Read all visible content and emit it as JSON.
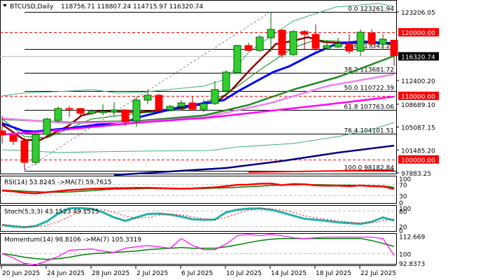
{
  "header": {
    "symbol_label": "BTCUSD,Daily",
    "ohlc": "118756.71 118807.24 114715.97 116320.74",
    "menu_icon": "triangle-down-icon"
  },
  "colors": {
    "bull": "#32cd32",
    "bear": "#ff0000",
    "ma_fast": "#8b0000",
    "ma_mid": "#0000ff",
    "ma_10": "#008000",
    "ma_50": "#228b22",
    "ma_100": "#ee82ee",
    "ma_200": "#ff00ff",
    "ma_long": "#000080",
    "bands": "#3cb371",
    "level": "#ff0000",
    "fib": "#000000",
    "stoch_main": "#20b2aa",
    "stoch_signal": "#ff0000",
    "mom": "#ff00ff",
    "mom_ma": "#008000"
  },
  "chart_data": {
    "type": "candlestick",
    "title": "BTCUSD,Daily",
    "ylim": [
      97660,
      124860
    ],
    "dates": [
      "20 Jun 2025",
      "24 Jun 2025",
      "28 Jun 2025",
      "2 Jul 2025",
      "6 Jul 2025",
      "10 Jul 2025",
      "14 Jul 2025",
      "18 Jul 2025",
      "22 Jul 2025"
    ],
    "date_every_bars": 4,
    "ohlc": [
      [
        104489,
        106800,
        102508,
        103829
      ],
      [
        103829,
        103829,
        102288,
        102838
      ],
      [
        102948,
        103388,
        98324,
        99535
      ],
      [
        99535,
        104159,
        99095,
        103939
      ],
      [
        103939,
        106581,
        103700,
        106361
      ],
      [
        106141,
        108343,
        105811,
        108013
      ],
      [
        108013,
        108343,
        106692,
        107902
      ],
      [
        108013,
        108100,
        106692,
        107242
      ],
      [
        107242,
        107682,
        106912,
        107572
      ],
      [
        107352,
        108673,
        106912,
        107572
      ],
      [
        107462,
        109003,
        106802,
        107792
      ],
      [
        107792,
        107900,
        105256,
        105921
      ],
      [
        106031,
        109884,
        105150,
        109334
      ],
      [
        109334,
        110985,
        108673,
        110105
      ],
      [
        110105,
        110300,
        107600,
        107792
      ],
      [
        107792,
        108563,
        107682,
        108343
      ],
      [
        108343,
        109334,
        108200,
        108893
      ],
      [
        108893,
        109884,
        107682,
        107902
      ],
      [
        107902,
        109444,
        107462,
        108783
      ],
      [
        108783,
        112306,
        108563,
        110985
      ],
      [
        110765,
        114068,
        110500,
        113737
      ],
      [
        113627,
        118032,
        113516,
        117921
      ],
      [
        117921,
        118362,
        117040,
        117151
      ],
      [
        117151,
        119573,
        116900,
        119242
      ],
      [
        119132,
        123261.94,
        116930,
        120454
      ],
      [
        120343,
        120454,
        115940,
        116490
      ],
      [
        116490,
        120343,
        116270,
        120123
      ],
      [
        120123,
        120343,
        117371,
        119683
      ],
      [
        119683,
        121224,
        117000,
        117481
      ],
      [
        117481,
        118692,
        117261,
        117921
      ],
      [
        117701,
        119132,
        117481,
        118251
      ],
      [
        118251,
        119683,
        116600,
        117040
      ],
      [
        117040,
        120454,
        116270,
        120013
      ],
      [
        119903,
        120454,
        117481,
        118141
      ],
      [
        118141,
        119683,
        117261,
        118912
      ],
      [
        118756.71,
        118807.24,
        114715.97,
        116320.74
      ]
    ],
    "overlays": [
      {
        "name": "ma-fast",
        "color": "ma_fast",
        "width": 2.5,
        "points": [
          [
            0,
            105480
          ],
          [
            2,
            103058
          ],
          [
            3.4,
            103058
          ],
          [
            5.9,
            105260
          ],
          [
            7.1,
            106912
          ],
          [
            8.6,
            107572
          ],
          [
            12.3,
            107462
          ],
          [
            15.9,
            108013
          ],
          [
            19.2,
            109114
          ],
          [
            20.4,
            110765
          ],
          [
            22.3,
            114398
          ],
          [
            24.2,
            117701
          ],
          [
            24.4,
            118141
          ],
          [
            26.1,
            118692
          ],
          [
            27.3,
            119242
          ],
          [
            28.7,
            118471
          ],
          [
            30.9,
            118251
          ],
          [
            33,
            118471
          ],
          [
            35,
            118141
          ]
        ]
      },
      {
        "name": "ma-10",
        "color": "ma_10",
        "width": 1,
        "points": [
          [
            0,
            106361
          ],
          [
            2,
            103608
          ],
          [
            4,
            103388
          ],
          [
            8,
            106361
          ],
          [
            12,
            107242
          ],
          [
            16,
            107792
          ],
          [
            20,
            110214
          ],
          [
            23,
            114068
          ],
          [
            26,
            117591
          ],
          [
            28,
            118802
          ],
          [
            31,
            118471
          ],
          [
            35,
            118031
          ]
        ]
      },
      {
        "name": "ma-mid",
        "color": "ma_mid",
        "width": 3,
        "points": [
          [
            0,
            105700
          ],
          [
            1.9,
            104489
          ],
          [
            2.9,
            104380
          ],
          [
            6.1,
            104930
          ],
          [
            9.2,
            105590
          ],
          [
            11.5,
            106141
          ],
          [
            12.3,
            106692
          ],
          [
            15.9,
            108233
          ],
          [
            19.8,
            109334
          ],
          [
            21.1,
            110765
          ],
          [
            24.2,
            113737
          ],
          [
            25.6,
            114618
          ],
          [
            27.8,
            116600
          ],
          [
            29.8,
            118141
          ],
          [
            31.9,
            118582
          ],
          [
            35,
            118251
          ]
        ]
      },
      {
        "name": "ma-50",
        "color": "ma_50",
        "width": 2.5,
        "points": [
          [
            0,
            106361
          ],
          [
            6,
            105811
          ],
          [
            12,
            106031
          ],
          [
            18,
            106912
          ],
          [
            22,
            108563
          ],
          [
            26,
            110985
          ],
          [
            30,
            112967
          ],
          [
            35,
            116270
          ]
        ]
      },
      {
        "name": "ma-100",
        "color": "ma_100",
        "width": 2.5,
        "points": [
          [
            0,
            106471
          ],
          [
            6,
            105700
          ],
          [
            12.3,
            105921
          ],
          [
            18,
            106581
          ],
          [
            24,
            108893
          ],
          [
            29,
            111535
          ],
          [
            35,
            113407
          ]
        ]
      },
      {
        "name": "ma-200",
        "color": "ma_200",
        "width": 2.5,
        "points": [
          [
            0,
            103939
          ],
          [
            3,
            104269
          ],
          [
            12.3,
            105811
          ],
          [
            18.5,
            106581
          ],
          [
            28.6,
            108563
          ],
          [
            35,
            109884
          ]
        ]
      },
      {
        "name": "ma-long",
        "color": "ma_long",
        "width": 2.5,
        "points": [
          [
            10,
            97553
          ],
          [
            20,
            98654
          ],
          [
            25,
            99755
          ],
          [
            30,
            101076
          ],
          [
            35,
            102178
          ]
        ]
      },
      {
        "name": "ma-red-long",
        "color": "level",
        "width": 2,
        "points": [
          [
            22,
            97993
          ],
          [
            35,
            98324
          ]
        ]
      },
      {
        "name": "band-upper",
        "color": "bands",
        "width": 1,
        "points": [
          [
            0,
            109994
          ],
          [
            1.9,
            110434
          ],
          [
            6.1,
            110765
          ],
          [
            8.1,
            110985
          ],
          [
            10.3,
            110434
          ],
          [
            12.3,
            110544
          ],
          [
            18,
            111535
          ],
          [
            20,
            112636
          ],
          [
            21.1,
            114948
          ],
          [
            22.1,
            117040
          ],
          [
            26,
            121775
          ],
          [
            29.8,
            123977
          ],
          [
            33.6,
            124527
          ],
          [
            35,
            124087
          ]
        ]
      },
      {
        "name": "band-lower",
        "color": "bands",
        "width": 1,
        "points": [
          [
            0,
            101516
          ],
          [
            2,
            101406
          ],
          [
            5,
            101076
          ],
          [
            8,
            101186
          ],
          [
            12,
            101296
          ],
          [
            18.6,
            101406
          ],
          [
            21,
            101957
          ],
          [
            26,
            102508
          ],
          [
            30,
            103608
          ],
          [
            33,
            104709
          ],
          [
            35,
            105811
          ]
        ]
      }
    ],
    "fibonacci": [
      {
        "label": "0.0 123261.94",
        "price": 123261.94
      },
      {
        "label": "23.6 117343.27",
        "price": 117343.27
      },
      {
        "label": "38.2 113681.72",
        "price": 113681.72
      },
      {
        "label": "50.0 110722.39",
        "price": 110722.39
      },
      {
        "label": "61.8 107763.06",
        "price": 107763.06
      },
      {
        "label": "76.4 104101.51",
        "price": 104101.51
      },
      {
        "label": "100.0 98182.84",
        "price": 98182.84
      }
    ],
    "levels": [
      {
        "label": "120000.00",
        "price": 120000
      },
      {
        "label": "110000.00",
        "price": 110000
      },
      {
        "label": "100000.00",
        "price": 100000
      }
    ],
    "current_price": {
      "label": "116320.74",
      "price": 116320.74
    },
    "axis_ticks": [
      {
        "label": "123206.05",
        "price": 123206.05
      },
      {
        "label": "112400.20",
        "price": 112400.2
      },
      {
        "label": "108689.10",
        "price": 108689.1
      },
      {
        "label": "105087.15",
        "price": 105087.15
      },
      {
        "label": "101485.20",
        "price": 101485.2
      },
      {
        "label": "97883.25",
        "price": 97883.25
      }
    ],
    "indicators": [
      {
        "name": "rsi",
        "title": "RSI(14) 53.8245  ->MA(7) 59.7615",
        "ylim": [
          0,
          100
        ],
        "levels": [
          70,
          30
        ],
        "ticks": [
          "100",
          "70",
          "30",
          "0"
        ],
        "tick_values": [
          100,
          70,
          30,
          0
        ],
        "series": [
          {
            "name": "rsi-ma",
            "color": "ma_10",
            "width": 1.5,
            "values": [
              50,
              48,
              46,
              44,
              42,
              42,
              43,
              45,
              48,
              51,
              53,
              54,
              55,
              56,
              56,
              56,
              56,
              56,
              56,
              57,
              58,
              60,
              62,
              64,
              67,
              68,
              69,
              70,
              70,
              69,
              68,
              68,
              67,
              66,
              65,
              60
            ]
          },
          {
            "name": "rsi-line",
            "color": "level",
            "width": 2.5,
            "values": [
              48,
              45,
              40,
              38,
              42,
              46,
              50,
              52,
              55,
              56,
              57,
              57,
              58,
              58,
              57,
              56,
              55,
              56,
              58,
              60,
              64,
              69,
              70,
              73,
              74,
              68,
              72,
              71,
              67,
              66,
              66,
              64,
              67,
              64,
              63,
              54
            ]
          }
        ]
      },
      {
        "name": "stoch",
        "title": "Stoch(5,3,3) 43.1523 49.1515",
        "ylim": [
          0,
          100
        ],
        "levels": [
          80,
          20
        ],
        "ticks": [
          "100",
          "80",
          "20",
          "0"
        ],
        "tick_values": [
          100,
          80,
          20,
          0
        ],
        "series": [
          {
            "name": "stoch-main",
            "color": "stoch_main",
            "width": 3,
            "values": [
              26,
              20,
              17,
              22,
              40,
              70,
              90,
              91,
              88,
              75,
              55,
              42,
              55,
              68,
              70,
              66,
              58,
              48,
              46,
              47,
              75,
              85,
              89,
              90,
              85,
              74,
              62,
              50,
              46,
              42,
              36,
              33,
              30,
              38,
              55,
              43
            ]
          },
          {
            "name": "stoch-signal",
            "color": "stoch_signal",
            "width": 1,
            "dash": "2,3",
            "values": [
              28,
              24,
              20,
              19,
              25,
              38,
              58,
              78,
              88,
              85,
              75,
              60,
              52,
              55,
              64,
              68,
              65,
              57,
              50,
              46,
              55,
              70,
              84,
              88,
              88,
              84,
              75,
              62,
              53,
              48,
              42,
              37,
              33,
              34,
              42,
              49
            ]
          }
        ]
      },
      {
        "name": "momentum",
        "title": "Momentum(14) 98.8106  ->MA(7) 105.3319",
        "ylim": [
          92.2,
          114.4
        ],
        "levels": [
          100
        ],
        "ticks": [
          "112.669",
          "100",
          "92.8373"
        ],
        "tick_values": [
          112.669,
          100,
          92.8373
        ],
        "series": [
          {
            "name": "momentum-ma",
            "color": "mom_ma",
            "width": 1.5,
            "values": [
              100,
              99,
              97.5,
              96.5,
              96,
              96.5,
              97.5,
              99,
              100,
              100.5,
              101,
              101.5,
              102,
              103,
              103.5,
              104,
              104.5,
              104,
              104,
              104,
              105,
              106.5,
              108,
              109.5,
              110.5,
              111,
              111,
              111,
              111,
              111,
              111,
              111,
              111,
              109.5,
              107.5,
              105.3
            ]
          },
          {
            "name": "momentum-line",
            "color": "mom",
            "width": 1.2,
            "values": [
              100,
              97,
              93,
              92,
              95,
              98,
              102.5,
              103,
              103.5,
              102,
              101,
              104,
              105,
              106,
              105,
              104,
              111,
              106,
              103,
              103,
              107,
              113,
              114,
              113,
              114,
              113,
              111.5,
              111,
              111.5,
              112,
              112,
              112,
              112,
              112,
              111,
              98.8
            ]
          }
        ]
      }
    ]
  }
}
